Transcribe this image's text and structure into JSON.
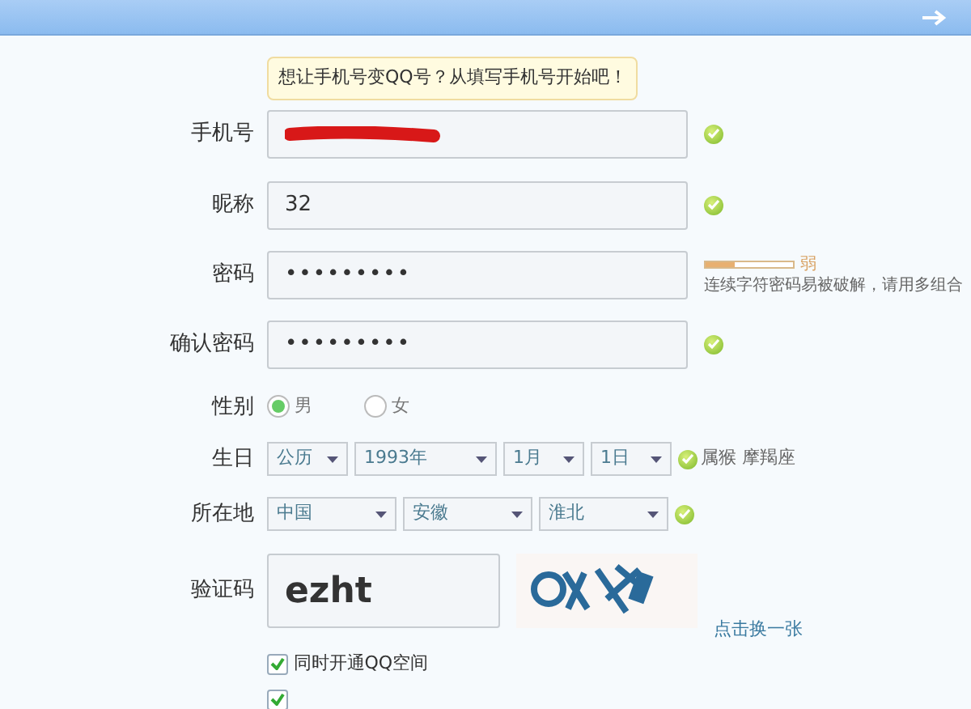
{
  "tooltip": "想让手机号变QQ号？从填写手机号开始吧！",
  "fields": [
    {
      "kind": "redacted",
      "label": "手机号",
      "valid": true
    },
    {
      "kind": "text",
      "label": "昵称",
      "value": "32",
      "valid": true
    },
    {
      "kind": "password",
      "label": "密码",
      "value": "•••••••••",
      "strength": {
        "level": 0.33,
        "label": "弱",
        "hint": "连续字符密码易被破解，请用多组合"
      }
    },
    {
      "kind": "password",
      "label": "确认密码",
      "value": "•••••••••",
      "valid": true
    },
    {
      "kind": "radio",
      "label": "性别",
      "options": [
        {
          "label": "男",
          "selected": true
        },
        {
          "label": "女",
          "selected": false
        }
      ]
    },
    {
      "kind": "selects",
      "label": "生日",
      "selects": [
        "公历",
        "1993年",
        "1月",
        "1日"
      ],
      "valid": true,
      "note": "属猴 摩羯座"
    },
    {
      "kind": "selects",
      "label": "所在地",
      "selects": [
        "中国",
        "安徽",
        "淮北"
      ],
      "valid": true
    },
    {
      "kind": "captcha",
      "label": "验证码",
      "value": "ezht",
      "link": "点击换一张"
    }
  ],
  "checkboxes": [
    {
      "label": "同时开通QQ空间",
      "checked": true
    },
    {
      "checked": true
    }
  ]
}
